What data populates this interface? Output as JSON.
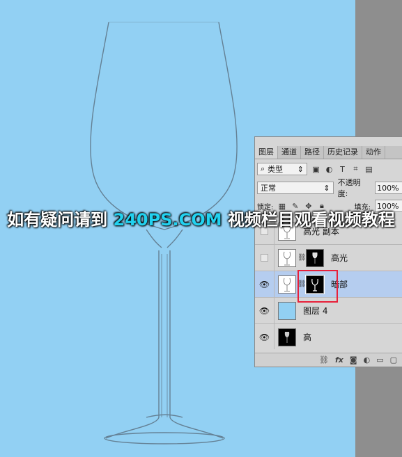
{
  "panel": {
    "tabs": [
      "图层",
      "通道",
      "路径",
      "历史记录",
      "动作"
    ],
    "filter": {
      "search_icon": "search-icon",
      "kind_label": "类型"
    },
    "blend": {
      "mode": "正常",
      "opacity_label": "不透明度:",
      "opacity_value": "100%"
    },
    "lock": {
      "lock_label": "锁定:",
      "fill_label": "填充:",
      "fill_value": "100%"
    },
    "layers": [
      {
        "name": "高光 副本",
        "visible": false,
        "has_mask": false,
        "selected": false
      },
      {
        "name": "高光",
        "visible": false,
        "has_mask": true,
        "selected": false
      },
      {
        "name": "暗部",
        "visible": true,
        "has_mask": true,
        "selected": true
      },
      {
        "name": "图层 4",
        "visible": true,
        "has_mask": false,
        "selected": false
      },
      {
        "name": "高",
        "visible": true,
        "has_mask": false,
        "selected": false
      }
    ],
    "bottom_fx": "fx"
  },
  "watermark": {
    "prefix": "如有疑问请到 ",
    "site": "240PS.COM",
    "suffix": " 视频栏目观看视频教程"
  },
  "colors": {
    "canvas": "#92d0f3",
    "highlight": "#e8203a",
    "selected_row": "#b5cdef",
    "accent": "#22d2f0"
  }
}
